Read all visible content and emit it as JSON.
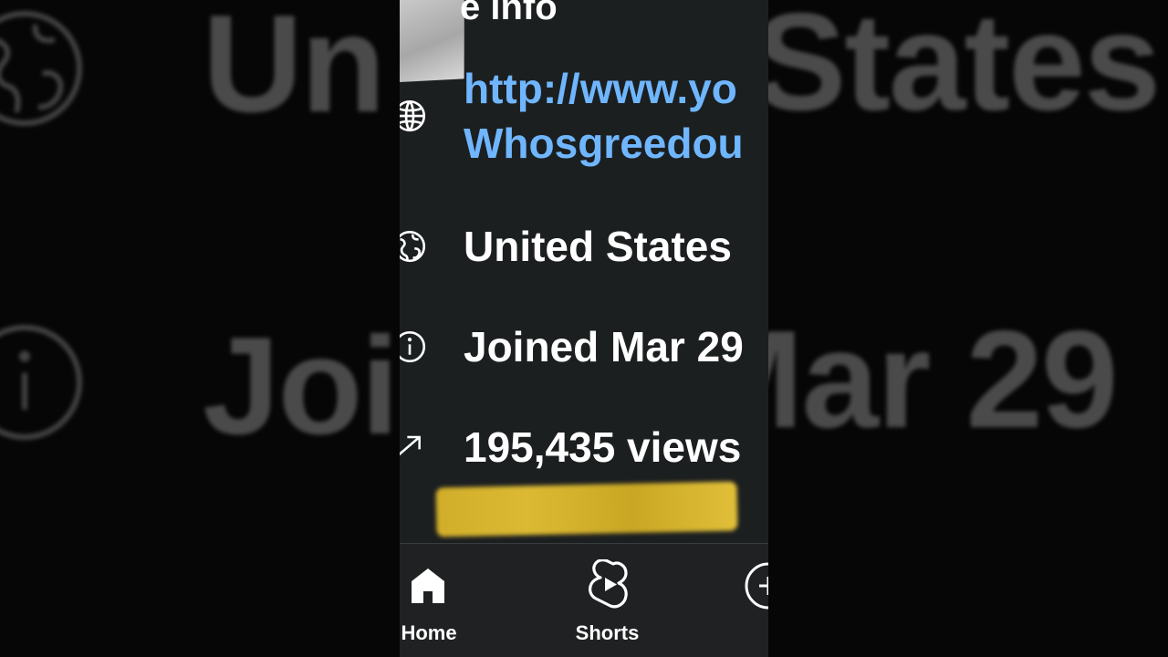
{
  "colors": {
    "phone_bg": "#1c1f20",
    "link_blue": "#6fb6ff",
    "text_white": "#ffffff",
    "highlight_yellow": "#ddb932",
    "nav_bg": "#1f2122",
    "background_dark": "#040404"
  },
  "background": {
    "left_line_1": "Un",
    "left_line_2": "Joi",
    "right_line_1": "States",
    "right_line_2": "Mar 29"
  },
  "profile_info": {
    "heading_fragment": "e info",
    "link_line_1": "http://www.yo",
    "link_line_2": "Whosgreedou",
    "location_text": "United States",
    "joined_text": "Joined Mar 29",
    "views_text": "195,435 views"
  },
  "icons": {
    "link": "globe-icon",
    "location": "earth-icon",
    "joined": "info-circle-icon",
    "views": "trend-arrow-icon",
    "home": "home-icon",
    "shorts": "shorts-icon",
    "create": "create-circle-icon"
  },
  "bottom_nav": {
    "items": [
      {
        "label": "Home"
      },
      {
        "label": "Shorts"
      },
      {
        "label": ""
      }
    ]
  }
}
